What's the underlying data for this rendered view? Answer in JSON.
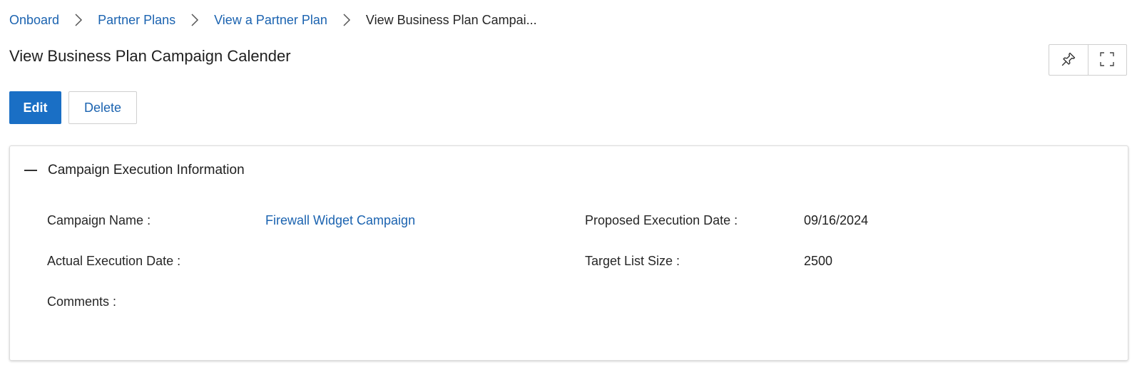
{
  "breadcrumb": {
    "items": [
      {
        "label": "Onboard"
      },
      {
        "label": "Partner Plans"
      },
      {
        "label": "View a Partner Plan"
      }
    ],
    "current": "View Business Plan Campai..."
  },
  "page": {
    "title": "View Business Plan Campaign Calender"
  },
  "toolbar": {
    "pin_icon": "pin-icon",
    "expand_icon": "fullscreen-icon"
  },
  "actions": {
    "edit_label": "Edit",
    "delete_label": "Delete"
  },
  "section": {
    "title": "Campaign Execution Information",
    "fields": {
      "campaign_name_label": "Campaign Name :",
      "campaign_name_value": "Firewall Widget Campaign",
      "proposed_date_label": "Proposed Execution Date :",
      "proposed_date_value": "09/16/2024",
      "actual_date_label": "Actual Execution Date :",
      "actual_date_value": "",
      "target_list_label": "Target List Size :",
      "target_list_value": "2500",
      "comments_label": "Comments :",
      "comments_value": ""
    }
  },
  "colors": {
    "link": "#1b63b0",
    "primary": "#1a6fc5"
  }
}
